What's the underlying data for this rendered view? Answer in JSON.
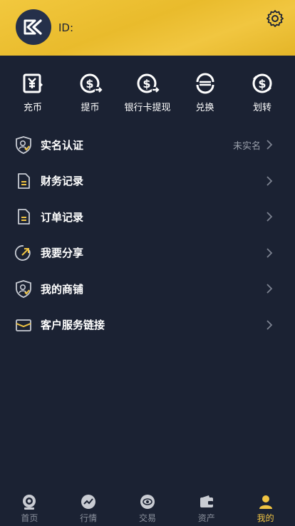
{
  "header": {
    "id_label": "ID:"
  },
  "quick_actions": [
    {
      "label": "充币",
      "icon": "deposit-icon"
    },
    {
      "label": "提币",
      "icon": "withdraw-icon"
    },
    {
      "label": "银行卡提现",
      "icon": "bank-withdraw-icon"
    },
    {
      "label": "兑换",
      "icon": "exchange-icon"
    },
    {
      "label": "划转",
      "icon": "transfer-icon"
    }
  ],
  "menu": [
    {
      "label": "实名认证",
      "value": "未实名",
      "icon": "shield-user-icon"
    },
    {
      "label": "财务记录",
      "value": "",
      "icon": "document-icon"
    },
    {
      "label": "订单记录",
      "value": "",
      "icon": "document-icon"
    },
    {
      "label": "我要分享",
      "value": "",
      "icon": "share-icon"
    },
    {
      "label": "我的商铺",
      "value": "",
      "icon": "shop-shield-icon"
    },
    {
      "label": "客户服务链接",
      "value": "",
      "icon": "mail-icon"
    }
  ],
  "tabs": [
    {
      "label": "首页",
      "icon": "home-icon",
      "active": false
    },
    {
      "label": "行情",
      "icon": "market-icon",
      "active": false
    },
    {
      "label": "交易",
      "icon": "trade-icon",
      "active": false
    },
    {
      "label": "资产",
      "icon": "wallet-icon",
      "active": false
    },
    {
      "label": "我的",
      "icon": "user-icon",
      "active": true
    }
  ],
  "colors": {
    "accent": "#f0c443",
    "background": "#1b2233",
    "header": "#ecbf33"
  }
}
